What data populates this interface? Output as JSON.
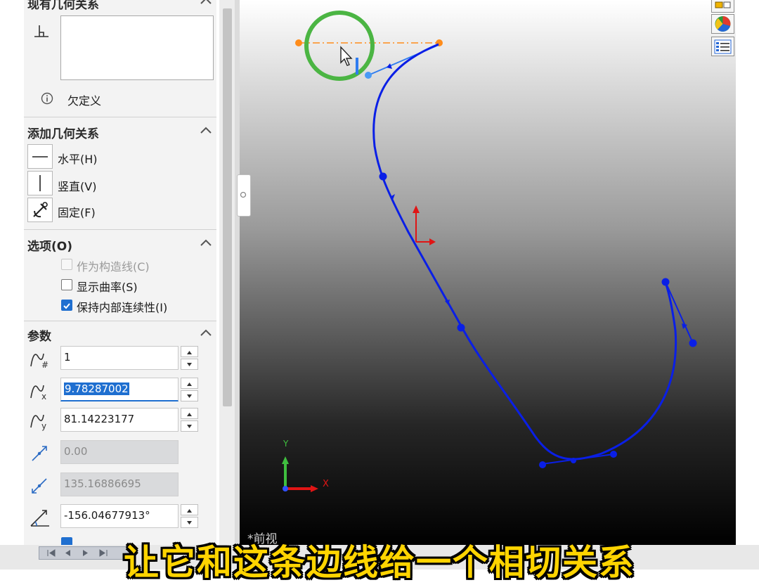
{
  "sections": {
    "existing": {
      "title": "现有几何关系",
      "status_text": "欠定义",
      "status_icon": "info-icon"
    },
    "add": {
      "title": "添加几何关系",
      "items": [
        {
          "label": "水平(H)",
          "icon": "horizontal-line-icon"
        },
        {
          "label": "竖直(V)",
          "icon": "vertical-line-icon"
        },
        {
          "label": "固定(F)",
          "icon": "fix-anchor-icon"
        }
      ]
    },
    "options": {
      "title": "选项(O)",
      "items": [
        {
          "label": "作为构造线(C)",
          "checked": false,
          "disabled": true
        },
        {
          "label": "显示曲率(S)",
          "checked": false,
          "disabled": false
        },
        {
          "label": "保持内部连续性(I)",
          "checked": true,
          "disabled": false
        }
      ]
    },
    "params": {
      "title": "参数",
      "fields": [
        {
          "value": "1",
          "icon": "spline-point-number-icon",
          "spinner": true,
          "disabled": false
        },
        {
          "value": "9.78287002",
          "icon": "spline-x-coordinate-icon",
          "spinner": true,
          "disabled": false,
          "selected": true
        },
        {
          "value": "81.14223177",
          "icon": "spline-y-coordinate-icon",
          "spinner": true,
          "disabled": false
        },
        {
          "value": "0.00",
          "icon": "tangent-weight-1-icon",
          "spinner": false,
          "disabled": true
        },
        {
          "value": "135.16886695",
          "icon": "tangent-weight-2-icon",
          "spinner": false,
          "disabled": true
        },
        {
          "value": "-156.04677913°",
          "icon": "tangent-direction-icon",
          "spinner": true,
          "disabled": false
        }
      ]
    }
  },
  "viewport": {
    "view_label": "*前视",
    "axis_x": "X",
    "axis_y": "Y",
    "spline_color": "#0a1fe6",
    "highlight_color": "#4bb543",
    "relation_line_color": "#ff8c1a"
  },
  "caption": "让它和这条边线给一个相切关系",
  "colors": {
    "accent": "#1f6fd0",
    "caption": "#ffd400"
  }
}
